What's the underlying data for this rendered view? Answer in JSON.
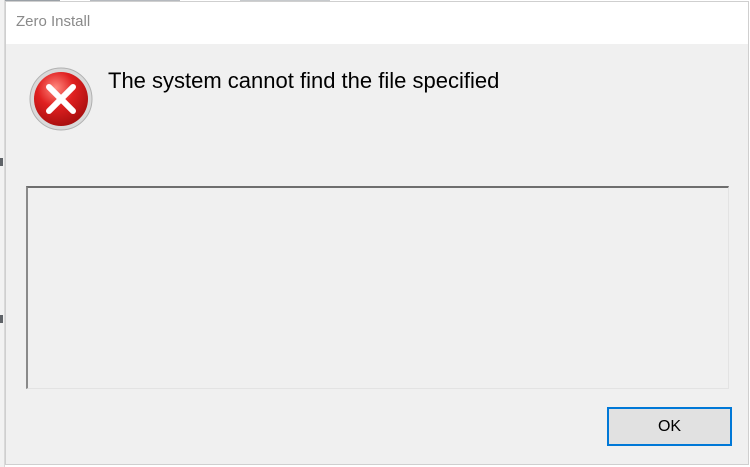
{
  "window": {
    "title": "Zero Install"
  },
  "message": {
    "text": "The system cannot find the file specified",
    "icon": "error-icon"
  },
  "details": {
    "value": ""
  },
  "buttons": {
    "ok_label": "OK"
  },
  "colors": {
    "error_red": "#d81e1e",
    "focus_border": "#0078d7",
    "dialog_bg": "#f0f0f0"
  }
}
